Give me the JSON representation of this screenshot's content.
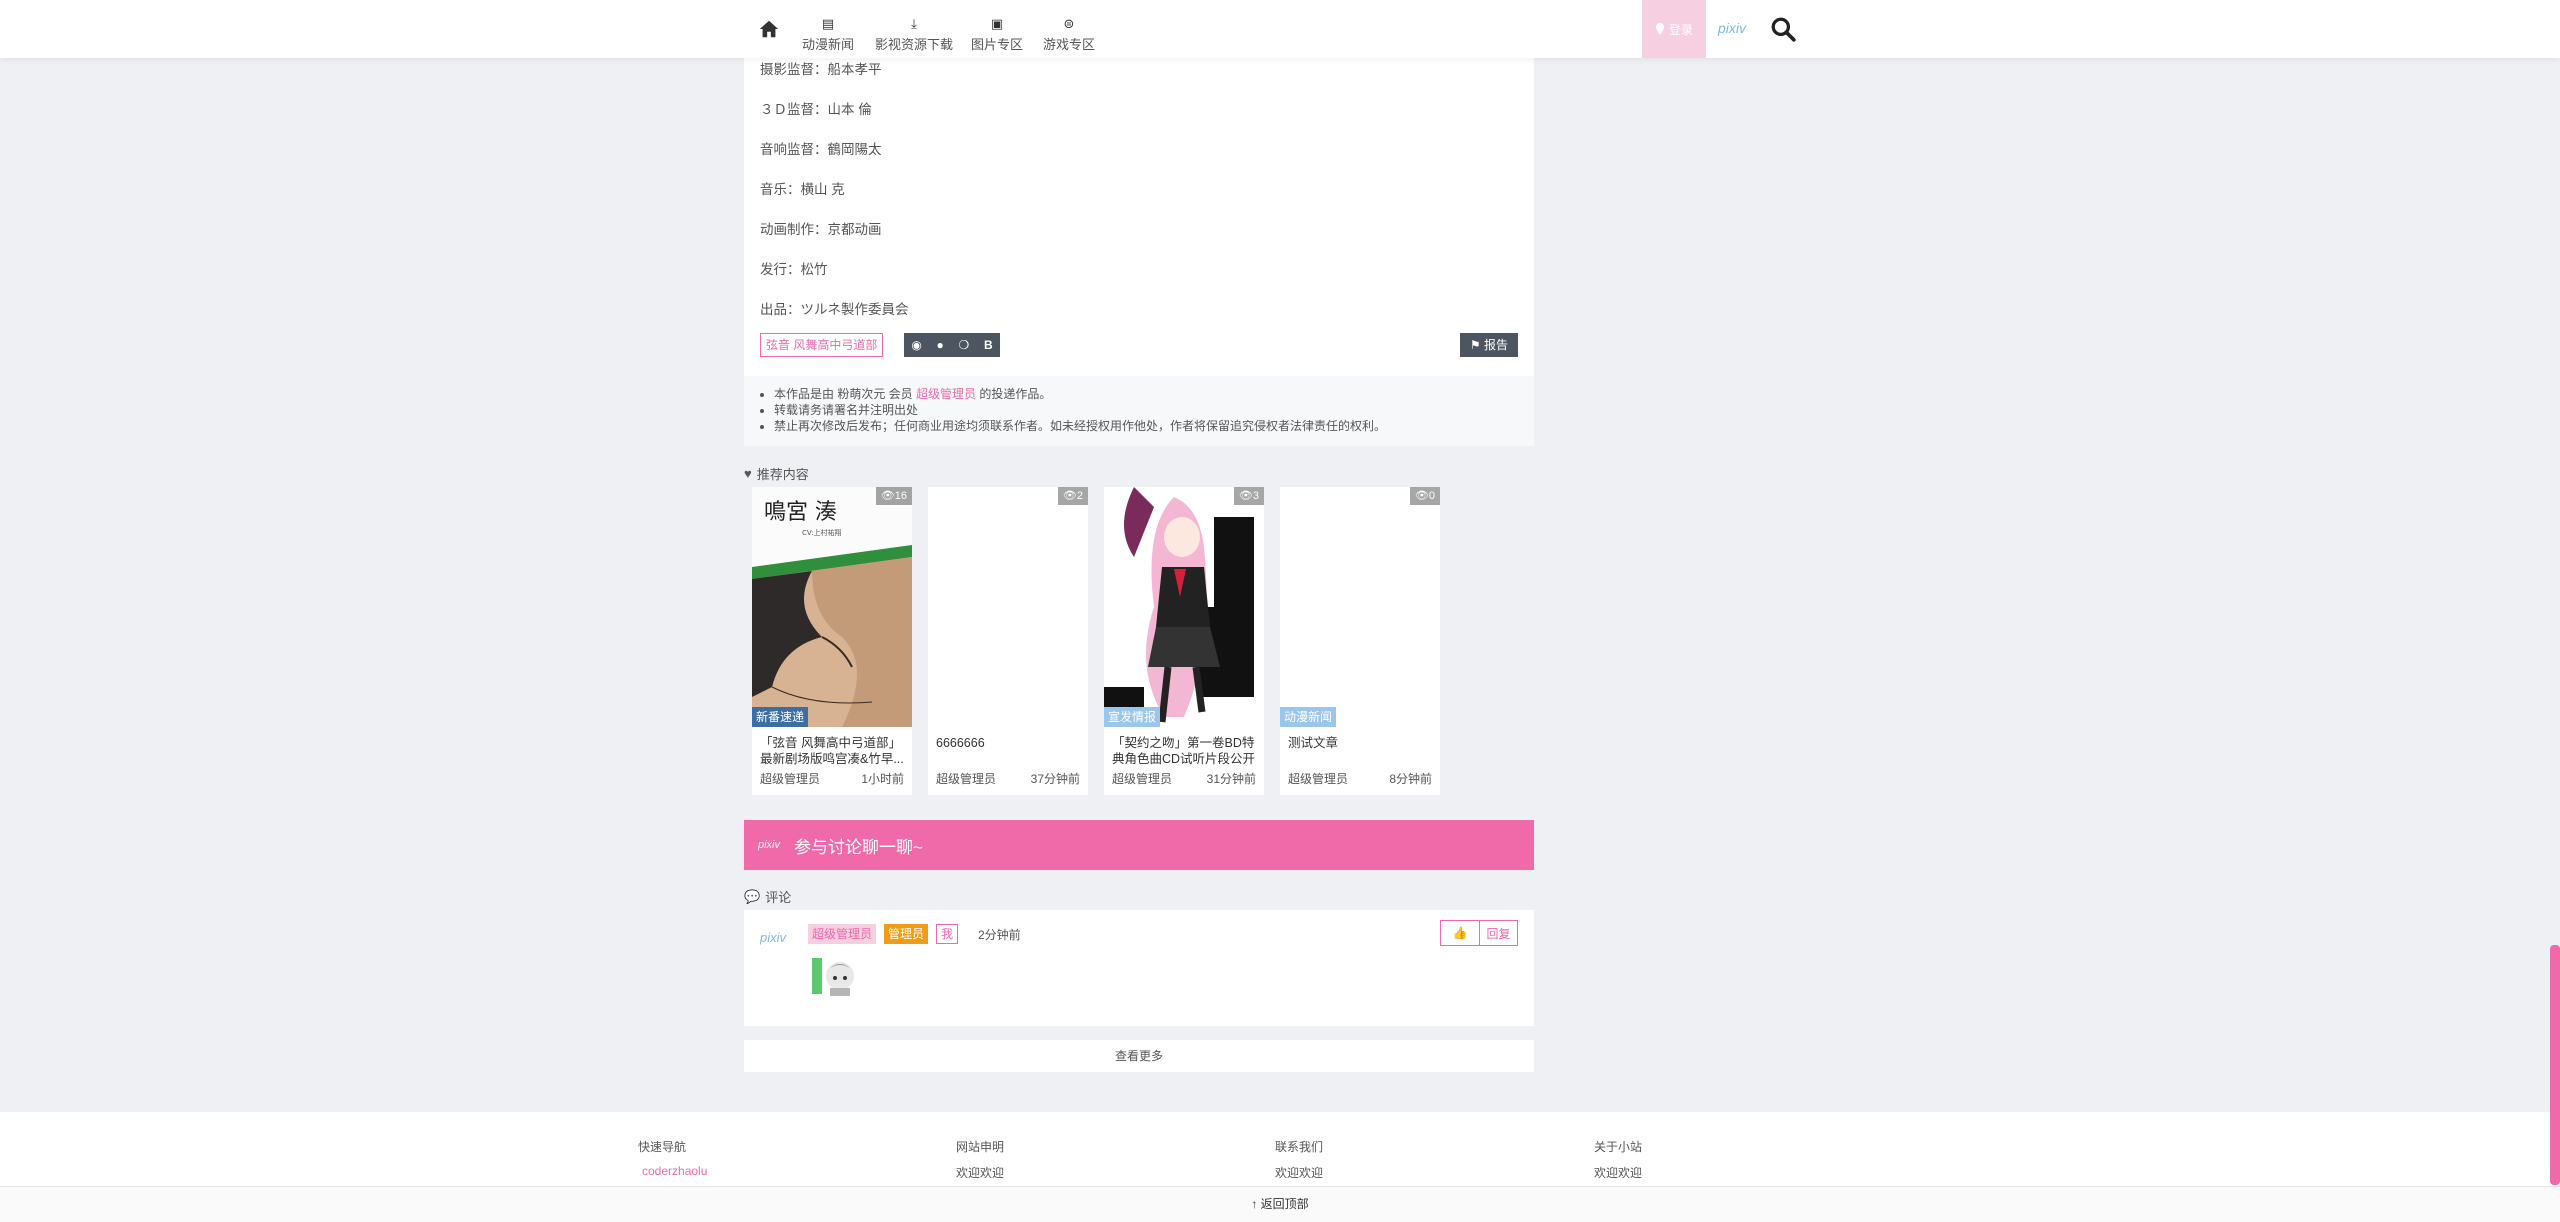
{
  "nav": {
    "items": [
      {
        "label": "动漫新闻",
        "icon": "news-icon"
      },
      {
        "label": "影视资源下载",
        "icon": "download-icon"
      },
      {
        "label": "图片专区",
        "icon": "images-icon"
      },
      {
        "label": "游戏专区",
        "icon": "gamepad-icon"
      }
    ],
    "login_label": "登录",
    "logo_text": "pixiv"
  },
  "article": {
    "credits": [
      "摄影监督：船本孝平",
      "３Ｄ监督：山本 倫",
      "音响监督：鶴岡陽太",
      "音乐：横山 克",
      "动画制作：京都动画",
      "发行：松竹",
      "出品：ツルネ製作委員会"
    ],
    "tag": "弦音 风舞高中弓道部",
    "share_icons": [
      "weibo-icon",
      "qq-icon",
      "wechat-icon",
      "bilibili-icon"
    ],
    "bilibili_letter": "B",
    "report_label": "报告",
    "notice": {
      "line1_prefix": "本作品是由 粉萌次元 会员",
      "line1_user": "超级管理员",
      "line1_suffix": "的投递作品。",
      "line2": "转载请务请署名并注明出处",
      "line3": "禁止再次修改后发布；任何商业用途均须联系作者。如未经授权用作他处，作者将保留追究侵权者法律责任的权利。"
    }
  },
  "recommend": {
    "title": "推荐内容",
    "cards": [
      {
        "views": "16",
        "category": "新番速递",
        "category_color": "#3a6ea5",
        "title": "「弦音 风舞高中弓道部」最新剧场版鸣宫凑&竹早...",
        "author": "超级管理员",
        "time": "1小时前",
        "cover_heading": "鳴宮 湊",
        "cover_sub": "CV:上村祐翔"
      },
      {
        "views": "2",
        "category": "",
        "category_color": "#3a6ea5",
        "title": "6666666",
        "author": "超级管理员",
        "time": "37分钟前"
      },
      {
        "views": "3",
        "category": "宣发情报",
        "category_color": "#9ac6ec",
        "title": "「契约之吻」第一卷BD特典角色曲CD试听片段公开",
        "author": "超级管理员",
        "time": "31分钟前"
      },
      {
        "views": "0",
        "category": "动漫新闻",
        "category_color": "#9ac6ec",
        "title": "测试文章",
        "author": "超级管理员",
        "time": "8分钟前"
      }
    ]
  },
  "discuss": {
    "mini_logo": "pixiv",
    "title": "参与讨论聊一聊~"
  },
  "comments": {
    "title": "评论",
    "item": {
      "logo": "pixiv",
      "user": "超级管理员",
      "role": "管理员",
      "me": "我",
      "time": "2分钟前",
      "reply_label": "回复"
    },
    "more_label": "查看更多"
  },
  "footer": {
    "cols": [
      {
        "heading": "快速导航",
        "text": "coderzhaolu"
      },
      {
        "heading": "网站申明",
        "text": "欢迎欢迎"
      },
      {
        "heading": "联系我们",
        "text": "欢迎欢迎"
      },
      {
        "heading": "关于小站",
        "text": "欢迎欢迎"
      }
    ],
    "backtop_label": "返回顶部"
  },
  "colors": {
    "accent": "#f06aa9",
    "dark_button": "#4d5560",
    "link_blue": "#7fb8e6"
  }
}
